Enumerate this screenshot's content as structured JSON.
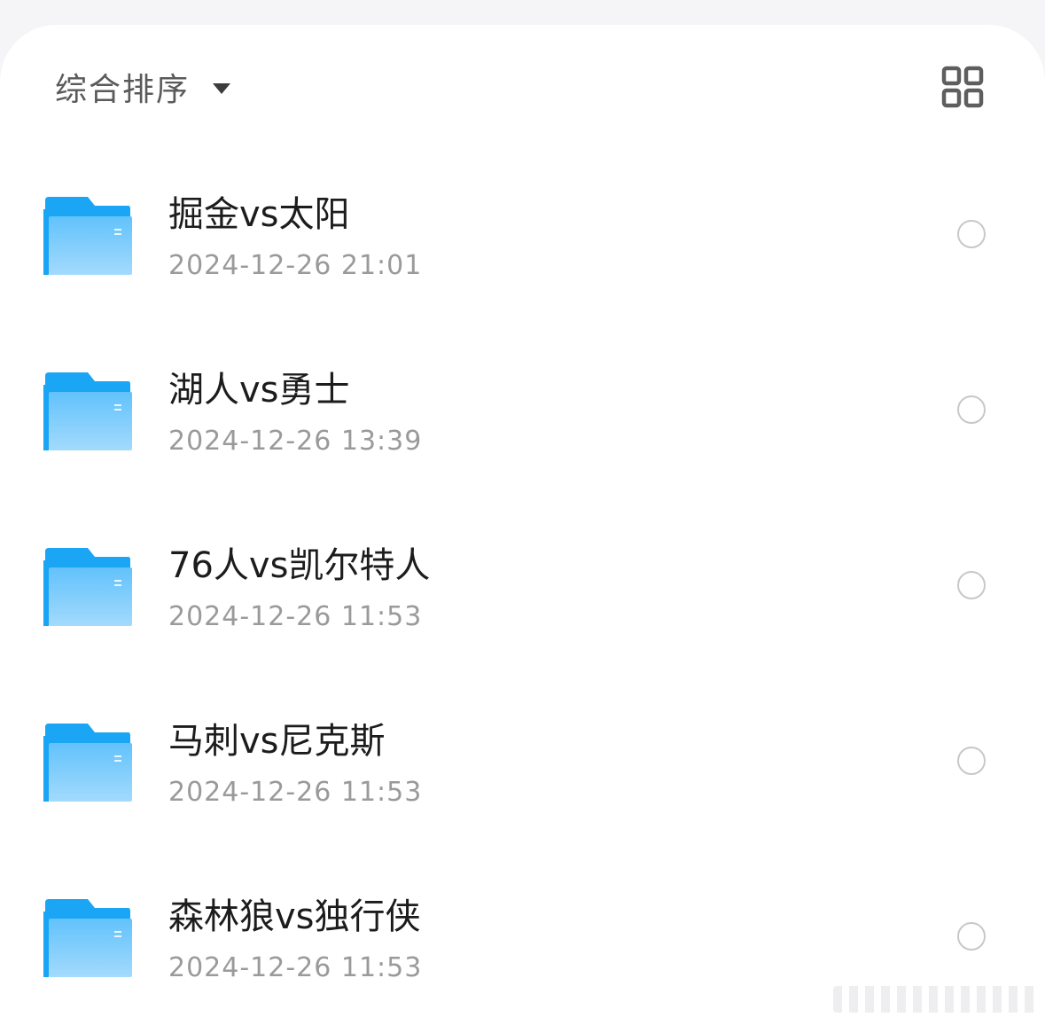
{
  "toolbar": {
    "sort_label": "综合排序",
    "sort_icon": "caret-down-icon",
    "view_icon": "grid-view-icon"
  },
  "colors": {
    "folder_tab": "#1ba5f5",
    "folder_front_top": "#62c2fb",
    "folder_front_bottom": "#9ed8fd",
    "title_text": "#1c1c1c",
    "date_text": "#9a9a9a",
    "checkbox_border": "#c8c8cc"
  },
  "files": [
    {
      "name": "掘金vs太阳",
      "date": "2024-12-26 21:01",
      "icon": "folder-icon"
    },
    {
      "name": "湖人vs勇士",
      "date": "2024-12-26 13:39",
      "icon": "folder-icon"
    },
    {
      "name": "76人vs凯尔特人",
      "date": "2024-12-26 11:53",
      "icon": "folder-icon"
    },
    {
      "name": "马刺vs尼克斯",
      "date": "2024-12-26 11:53",
      "icon": "folder-icon"
    },
    {
      "name": "森林狼vs独行侠",
      "date": "2024-12-26 11:53",
      "icon": "folder-icon"
    }
  ]
}
